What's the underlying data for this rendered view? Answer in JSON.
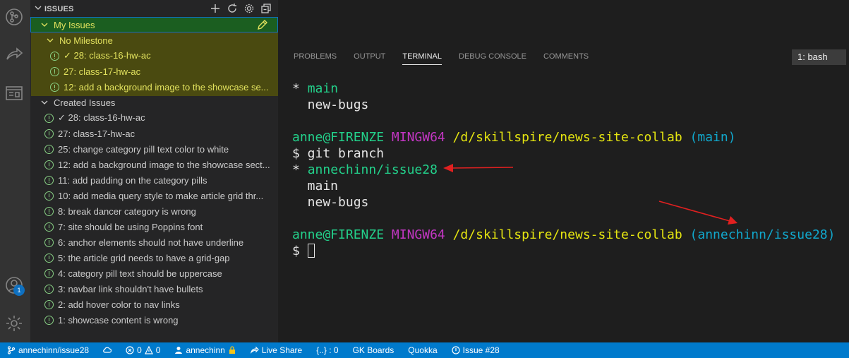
{
  "sidebar": {
    "title": "ISSUES",
    "my_issues": "My Issues",
    "no_milestone": "No Milestone",
    "milestone_issues": [
      "✓ 28: class-16-hw-ac",
      "27: class-17-hw-ac",
      "12: add a background image to the showcase se..."
    ],
    "created_issues": "Created Issues",
    "issues": [
      "✓ 28: class-16-hw-ac",
      "27: class-17-hw-ac",
      "25: change category pill text color to white",
      "12: add a background image to the showcase sect...",
      "11: add padding on the category pills",
      "10: add media query style to make article grid thr...",
      "8: break dancer category is wrong",
      "7: site should be using Poppins font",
      "6: anchor elements should not have underline",
      "5: the article grid needs to have a grid-gap",
      "4: category pill text should be uppercase",
      "3: navbar link shouldn't have bullets",
      "2: add hover color to nav links",
      "1: showcase content is wrong"
    ]
  },
  "activity": {
    "accounts_badge": "1"
  },
  "panel": {
    "tabs": [
      "PROBLEMS",
      "OUTPUT",
      "TERMINAL",
      "DEBUG CONSOLE",
      "COMMENTS"
    ],
    "active_tab": "TERMINAL",
    "terminal_selector": "1: bash"
  },
  "terminal": {
    "l1_star": "* ",
    "l1_branch": "main",
    "l2": "  new-bugs",
    "prompt_user": "anne@FIRENZE",
    "prompt_env": "MINGW64",
    "prompt_path": "/d/skillspire/news-site-collab",
    "prompt_branch_1": "(main)",
    "cmd": "$ git branch",
    "l5_star": "* ",
    "l5_branch": "annechinn/issue28",
    "l6": "  main",
    "l7": "  new-bugs",
    "prompt_branch_2": "(annechinn/issue28)",
    "dollar": "$ "
  },
  "status": {
    "branch": "annechinn/issue28",
    "problems_errors": "0",
    "problems_warnings": "0",
    "account": "annechinn",
    "live_share": "Live Share",
    "json": "{..} : 0",
    "gk_boards": "GK Boards",
    "quokka": "Quokka",
    "issue": "Issue #28"
  },
  "colors": {
    "status_bar": "#007acc",
    "terminal_green": "#23d18b",
    "terminal_magenta": "#c336c3",
    "terminal_yellow": "#e5e510",
    "terminal_cyan": "#11a8cd",
    "annotation_arrow": "#e02020"
  }
}
